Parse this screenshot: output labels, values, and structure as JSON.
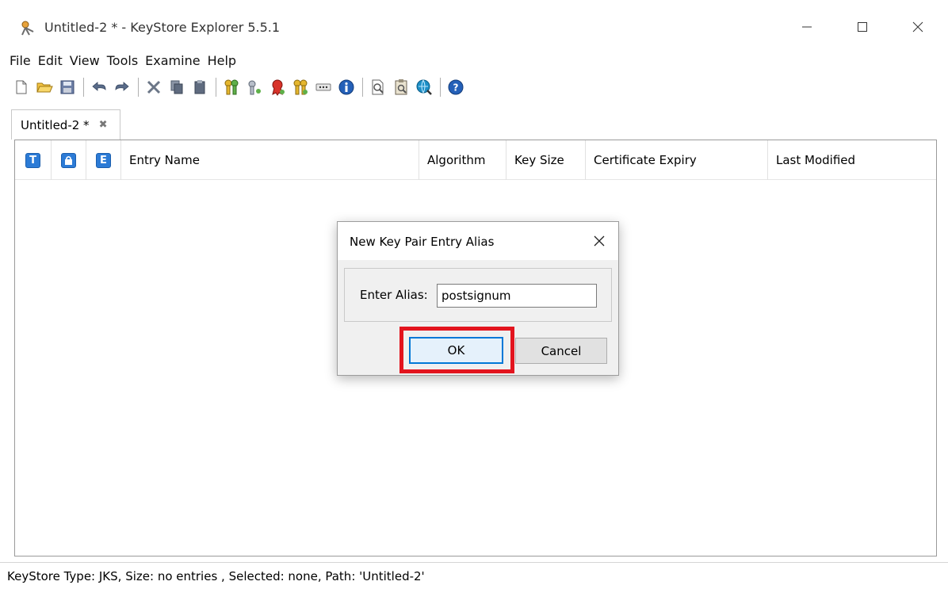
{
  "window": {
    "title": "Untitled-2 * - KeyStore Explorer 5.5.1",
    "app_icon": "keystore-explorer-icon",
    "controls": [
      "minimize-icon",
      "maximize-icon",
      "close-icon"
    ]
  },
  "menu": {
    "items": [
      {
        "label": "File"
      },
      {
        "label": "Edit"
      },
      {
        "label": "View"
      },
      {
        "label": "Tools"
      },
      {
        "label": "Examine"
      },
      {
        "label": "Help"
      }
    ]
  },
  "toolbar": {
    "icons": [
      "new-icon",
      "open-icon",
      "save-icon",
      "undo-icon",
      "redo-icon",
      "cut-icon",
      "copy-icon",
      "paste-icon",
      "generate-key-pair-icon",
      "generate-secret-key-icon",
      "import-trusted-certificate-icon",
      "import-key-pair-icon",
      "set-password-icon",
      "properties-icon",
      "examine-file-icon",
      "examine-clipboard-icon",
      "examine-ssl-icon",
      "help-icon"
    ]
  },
  "tab": {
    "label": "Untitled-2 *",
    "close_glyph": "✖"
  },
  "table": {
    "icon_columns": [
      "T",
      "🔒",
      "E"
    ],
    "columns": [
      "Entry Name",
      "Algorithm",
      "Key Size",
      "Certificate Expiry",
      "Last Modified"
    ]
  },
  "dialog": {
    "title": "New Key Pair Entry Alias",
    "label": "Enter Alias:",
    "alias_value": "postsignum",
    "ok_label": "OK",
    "cancel_label": "Cancel"
  },
  "status": {
    "text": "KeyStore Type: JKS, Size: no entries , Selected: none, Path: 'Untitled-2'"
  },
  "colors": {
    "highlight": "#e3141e",
    "accent": "#0078d7",
    "badge": "#2c7bd6"
  }
}
